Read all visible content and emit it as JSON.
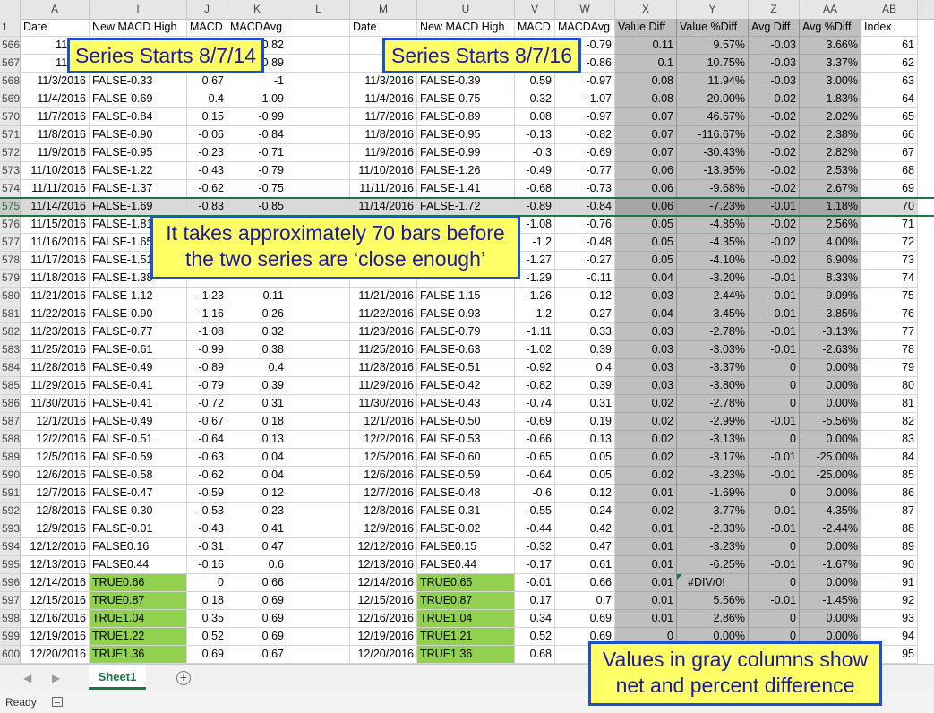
{
  "columns": [
    {
      "letter": "A",
      "w": 77
    },
    {
      "letter": "I",
      "w": 109
    },
    {
      "letter": "J",
      "w": 45
    },
    {
      "letter": "K",
      "w": 67
    },
    {
      "letter": "L",
      "w": 70
    },
    {
      "letter": "M",
      "w": 75
    },
    {
      "letter": "U",
      "w": 109
    },
    {
      "letter": "V",
      "w": 45
    },
    {
      "letter": "W",
      "w": 67
    },
    {
      "letter": "X",
      "w": 69
    },
    {
      "letter": "Y",
      "w": 80
    },
    {
      "letter": "Z",
      "w": 57
    },
    {
      "letter": "AA",
      "w": 69
    },
    {
      "letter": "AB",
      "w": 63
    }
  ],
  "header_row": {
    "num": "1",
    "cells": [
      "Date",
      "New MACD High",
      "MACD",
      "MACDAvg",
      "",
      "Date",
      "New MACD High",
      "MACD",
      "MACDAvg",
      "Value Diff",
      "Value %Diff",
      "Avg Diff",
      "Avg %Diff",
      "Index"
    ]
  },
  "rows": [
    {
      "num": "566",
      "cells": [
        "11/1/2",
        "",
        "",
        "0.82",
        "",
        "11/1",
        "",
        "",
        "-0.79",
        "0.11",
        "9.57%",
        "-0.03",
        "3.66%",
        "61"
      ]
    },
    {
      "num": "567",
      "cells": [
        "11/2/2",
        "",
        "",
        "0.89",
        "",
        "11/2",
        "",
        "",
        "-0.86",
        "0.1",
        "10.75%",
        "-0.03",
        "3.37%",
        "62"
      ]
    },
    {
      "num": "568",
      "cells": [
        "11/3/2016",
        "FALSE-0.33",
        "0.67",
        "-1",
        "",
        "11/3/2016",
        "FALSE-0.39",
        "0.59",
        "-0.97",
        "0.08",
        "11.94%",
        "-0.03",
        "3.00%",
        "63"
      ]
    },
    {
      "num": "569",
      "cells": [
        "11/4/2016",
        "FALSE-0.69",
        "0.4",
        "-1.09",
        "",
        "11/4/2016",
        "FALSE-0.75",
        "0.32",
        "-1.07",
        "0.08",
        "20.00%",
        "-0.02",
        "1.83%",
        "64"
      ]
    },
    {
      "num": "570",
      "cells": [
        "11/7/2016",
        "FALSE-0.84",
        "0.15",
        "-0.99",
        "",
        "11/7/2016",
        "FALSE-0.89",
        "0.08",
        "-0.97",
        "0.07",
        "46.67%",
        "-0.02",
        "2.02%",
        "65"
      ]
    },
    {
      "num": "571",
      "cells": [
        "11/8/2016",
        "FALSE-0.90",
        "-0.06",
        "-0.84",
        "",
        "11/8/2016",
        "FALSE-0.95",
        "-0.13",
        "-0.82",
        "0.07",
        "-116.67%",
        "-0.02",
        "2.38%",
        "66"
      ]
    },
    {
      "num": "572",
      "cells": [
        "11/9/2016",
        "FALSE-0.95",
        "-0.23",
        "-0.71",
        "",
        "11/9/2016",
        "FALSE-0.99",
        "-0.3",
        "-0.69",
        "0.07",
        "-30.43%",
        "-0.02",
        "2.82%",
        "67"
      ]
    },
    {
      "num": "573",
      "cells": [
        "11/10/2016",
        "FALSE-1.22",
        "-0.43",
        "-0.79",
        "",
        "11/10/2016",
        "FALSE-1.26",
        "-0.49",
        "-0.77",
        "0.06",
        "-13.95%",
        "-0.02",
        "2.53%",
        "68"
      ]
    },
    {
      "num": "574",
      "cells": [
        "11/11/2016",
        "FALSE-1.37",
        "-0.62",
        "-0.75",
        "",
        "11/11/2016",
        "FALSE-1.41",
        "-0.68",
        "-0.73",
        "0.06",
        "-9.68%",
        "-0.02",
        "2.67%",
        "69"
      ]
    },
    {
      "num": "575",
      "selected": true,
      "cells": [
        "11/14/2016",
        "FALSE-1.69",
        "-0.83",
        "-0.85",
        "",
        "11/14/2016",
        "FALSE-1.72",
        "-0.89",
        "-0.84",
        "0.06",
        "-7.23%",
        "-0.01",
        "1.18%",
        "70"
      ]
    },
    {
      "num": "576",
      "cells": [
        "11/15/2016",
        "FALSE-1.81",
        "",
        "",
        "",
        "",
        "",
        "-1.08",
        "-0.76",
        "0.05",
        "-4.85%",
        "-0.02",
        "2.56%",
        "71"
      ]
    },
    {
      "num": "577",
      "cells": [
        "11/16/2016",
        "FALSE-1.65",
        "",
        "",
        "",
        "",
        "",
        "-1.2",
        "-0.48",
        "0.05",
        "-4.35%",
        "-0.02",
        "4.00%",
        "72"
      ]
    },
    {
      "num": "578",
      "cells": [
        "11/17/2016",
        "FALSE-1.51",
        "",
        "",
        "",
        "",
        "",
        "-1.27",
        "-0.27",
        "0.05",
        "-4.10%",
        "-0.02",
        "6.90%",
        "73"
      ]
    },
    {
      "num": "579",
      "cells": [
        "11/18/2016",
        "FALSE-1.38",
        "",
        "",
        "",
        "",
        "",
        "-1.29",
        "-0.11",
        "0.04",
        "-3.20%",
        "-0.01",
        "8.33%",
        "74"
      ]
    },
    {
      "num": "580",
      "cells": [
        "11/21/2016",
        "FALSE-1.12",
        "-1.23",
        "0.11",
        "",
        "11/21/2016",
        "FALSE-1.15",
        "-1.26",
        "0.12",
        "0.03",
        "-2.44%",
        "-0.01",
        "-9.09%",
        "75"
      ]
    },
    {
      "num": "581",
      "cells": [
        "11/22/2016",
        "FALSE-0.90",
        "-1.16",
        "0.26",
        "",
        "11/22/2016",
        "FALSE-0.93",
        "-1.2",
        "0.27",
        "0.04",
        "-3.45%",
        "-0.01",
        "-3.85%",
        "76"
      ]
    },
    {
      "num": "582",
      "cells": [
        "11/23/2016",
        "FALSE-0.77",
        "-1.08",
        "0.32",
        "",
        "11/23/2016",
        "FALSE-0.79",
        "-1.11",
        "0.33",
        "0.03",
        "-2.78%",
        "-0.01",
        "-3.13%",
        "77"
      ]
    },
    {
      "num": "583",
      "cells": [
        "11/25/2016",
        "FALSE-0.61",
        "-0.99",
        "0.38",
        "",
        "11/25/2016",
        "FALSE-0.63",
        "-1.02",
        "0.39",
        "0.03",
        "-3.03%",
        "-0.01",
        "-2.63%",
        "78"
      ]
    },
    {
      "num": "584",
      "cells": [
        "11/28/2016",
        "FALSE-0.49",
        "-0.89",
        "0.4",
        "",
        "11/28/2016",
        "FALSE-0.51",
        "-0.92",
        "0.4",
        "0.03",
        "-3.37%",
        "0",
        "0.00%",
        "79"
      ]
    },
    {
      "num": "585",
      "cells": [
        "11/29/2016",
        "FALSE-0.41",
        "-0.79",
        "0.39",
        "",
        "11/29/2016",
        "FALSE-0.42",
        "-0.82",
        "0.39",
        "0.03",
        "-3.80%",
        "0",
        "0.00%",
        "80"
      ]
    },
    {
      "num": "586",
      "cells": [
        "11/30/2016",
        "FALSE-0.41",
        "-0.72",
        "0.31",
        "",
        "11/30/2016",
        "FALSE-0.43",
        "-0.74",
        "0.31",
        "0.02",
        "-2.78%",
        "0",
        "0.00%",
        "81"
      ]
    },
    {
      "num": "587",
      "cells": [
        "12/1/2016",
        "FALSE-0.49",
        "-0.67",
        "0.18",
        "",
        "12/1/2016",
        "FALSE-0.50",
        "-0.69",
        "0.19",
        "0.02",
        "-2.99%",
        "-0.01",
        "-5.56%",
        "82"
      ]
    },
    {
      "num": "588",
      "cells": [
        "12/2/2016",
        "FALSE-0.51",
        "-0.64",
        "0.13",
        "",
        "12/2/2016",
        "FALSE-0.53",
        "-0.66",
        "0.13",
        "0.02",
        "-3.13%",
        "0",
        "0.00%",
        "83"
      ]
    },
    {
      "num": "589",
      "cells": [
        "12/5/2016",
        "FALSE-0.59",
        "-0.63",
        "0.04",
        "",
        "12/5/2016",
        "FALSE-0.60",
        "-0.65",
        "0.05",
        "0.02",
        "-3.17%",
        "-0.01",
        "-25.00%",
        "84"
      ]
    },
    {
      "num": "590",
      "cells": [
        "12/6/2016",
        "FALSE-0.58",
        "-0.62",
        "0.04",
        "",
        "12/6/2016",
        "FALSE-0.59",
        "-0.64",
        "0.05",
        "0.02",
        "-3.23%",
        "-0.01",
        "-25.00%",
        "85"
      ]
    },
    {
      "num": "591",
      "cells": [
        "12/7/2016",
        "FALSE-0.47",
        "-0.59",
        "0.12",
        "",
        "12/7/2016",
        "FALSE-0.48",
        "-0.6",
        "0.12",
        "0.01",
        "-1.69%",
        "0",
        "0.00%",
        "86"
      ]
    },
    {
      "num": "592",
      "cells": [
        "12/8/2016",
        "FALSE-0.30",
        "-0.53",
        "0.23",
        "",
        "12/8/2016",
        "FALSE-0.31",
        "-0.55",
        "0.24",
        "0.02",
        "-3.77%",
        "-0.01",
        "-4.35%",
        "87"
      ]
    },
    {
      "num": "593",
      "cells": [
        "12/9/2016",
        "FALSE-0.01",
        "-0.43",
        "0.41",
        "",
        "12/9/2016",
        "FALSE-0.02",
        "-0.44",
        "0.42",
        "0.01",
        "-2.33%",
        "-0.01",
        "-2.44%",
        "88"
      ]
    },
    {
      "num": "594",
      "cells": [
        "12/12/2016",
        "FALSE0.16",
        "-0.31",
        "0.47",
        "",
        "12/12/2016",
        "FALSE0.15",
        "-0.32",
        "0.47",
        "0.01",
        "-3.23%",
        "0",
        "0.00%",
        "89"
      ]
    },
    {
      "num": "595",
      "cells": [
        "12/13/2016",
        "FALSE0.44",
        "-0.16",
        "0.6",
        "",
        "12/13/2016",
        "FALSE0.44",
        "-0.17",
        "0.61",
        "0.01",
        "-6.25%",
        "-0.01",
        "-1.67%",
        "90"
      ]
    },
    {
      "num": "596",
      "cells": [
        "12/14/2016",
        "TRUE0.66",
        "0",
        "0.66",
        "",
        "12/14/2016",
        "TRUE0.65",
        "-0.01",
        "0.66",
        "0.01",
        "#DIV/0!",
        "0",
        "0.00%",
        "91"
      ]
    },
    {
      "num": "597",
      "cells": [
        "12/15/2016",
        "TRUE0.87",
        "0.18",
        "0.69",
        "",
        "12/15/2016",
        "TRUE0.87",
        "0.17",
        "0.7",
        "0.01",
        "5.56%",
        "-0.01",
        "-1.45%",
        "92"
      ]
    },
    {
      "num": "598",
      "cells": [
        "12/16/2016",
        "TRUE1.04",
        "0.35",
        "0.69",
        "",
        "12/16/2016",
        "TRUE1.04",
        "0.34",
        "0.69",
        "0.01",
        "2.86%",
        "0",
        "0.00%",
        "93"
      ]
    },
    {
      "num": "599",
      "cells": [
        "12/19/2016",
        "TRUE1.22",
        "0.52",
        "0.69",
        "",
        "12/19/2016",
        "TRUE1.21",
        "0.52",
        "0.69",
        "0",
        "0.00%",
        "0",
        "0.00%",
        "94"
      ]
    },
    {
      "num": "600",
      "cells": [
        "12/20/2016",
        "TRUE1.36",
        "0.69",
        "0.67",
        "",
        "12/20/2016",
        "TRUE1.36",
        "0.68",
        "",
        "",
        "",
        "",
        "",
        "95"
      ]
    }
  ],
  "callouts": {
    "left_series": "Series Starts 8/7/14",
    "right_series": "Series Starts 8/7/16",
    "approx_line1": "It takes approximately 70 bars before",
    "approx_line2": "the two series are ‘close enough’",
    "gray_line1": "Values in gray columns show",
    "gray_line2": "net and percent difference"
  },
  "tabs": {
    "sheet_name": "Sheet1",
    "add_label": "+",
    "prev": "◀",
    "next": "▶"
  },
  "status": {
    "ready": "Ready"
  },
  "colors": {
    "accent": "#217346",
    "gray_col": "#bfbfbf",
    "green_cell": "#92d050",
    "callout_bg": "#ffff66",
    "callout_border": "#1f4fd1",
    "callout_text": "#1a1aa6"
  }
}
